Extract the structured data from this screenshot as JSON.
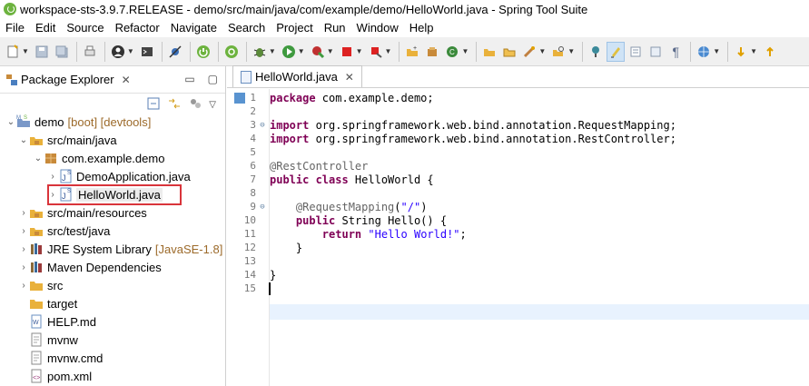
{
  "window": {
    "title": "workspace-sts-3.9.7.RELEASE - demo/src/main/java/com/example/demo/HelloWorld.java - Spring Tool Suite"
  },
  "menu": [
    "File",
    "Edit",
    "Source",
    "Refactor",
    "Navigate",
    "Search",
    "Project",
    "Run",
    "Window",
    "Help"
  ],
  "package_explorer": {
    "tab_label": "Package Explorer",
    "tree": [
      {
        "label": "demo",
        "deco": "[boot] [devtools]",
        "expanded": true,
        "level": 0,
        "icon": "project-icon"
      },
      {
        "label": "src/main/java",
        "deco": "",
        "expanded": true,
        "level": 1,
        "icon": "source-folder-icon"
      },
      {
        "label": "com.example.demo",
        "deco": "",
        "expanded": true,
        "level": 2,
        "icon": "package-icon"
      },
      {
        "label": "DemoApplication.java",
        "deco": "",
        "expanded": false,
        "level": 3,
        "icon": "java-file-icon"
      },
      {
        "label": "HelloWorld.java",
        "deco": "",
        "expanded": false,
        "level": 3,
        "icon": "java-file-icon"
      },
      {
        "label": "src/main/resources",
        "deco": "",
        "expanded": false,
        "level": 1,
        "icon": "source-folder-icon"
      },
      {
        "label": "src/test/java",
        "deco": "",
        "expanded": false,
        "level": 1,
        "icon": "source-folder-icon"
      },
      {
        "label": "JRE System Library",
        "deco": "[JavaSE-1.8]",
        "expanded": false,
        "level": 1,
        "icon": "library-icon"
      },
      {
        "label": "Maven Dependencies",
        "deco": "",
        "expanded": false,
        "level": 1,
        "icon": "library-icon"
      },
      {
        "label": "src",
        "deco": "",
        "expanded": false,
        "level": 1,
        "icon": "folder-icon"
      },
      {
        "label": "target",
        "deco": "",
        "expanded": null,
        "level": 1,
        "icon": "folder-icon"
      },
      {
        "label": "HELP.md",
        "deco": "",
        "expanded": null,
        "level": 1,
        "icon": "file-icon"
      },
      {
        "label": "mvnw",
        "deco": "",
        "expanded": null,
        "level": 1,
        "icon": "file-icon"
      },
      {
        "label": "mvnw.cmd",
        "deco": "",
        "expanded": null,
        "level": 1,
        "icon": "file-icon"
      },
      {
        "label": "pom.xml",
        "deco": "",
        "expanded": null,
        "level": 1,
        "icon": "xml-file-icon"
      }
    ]
  },
  "editor": {
    "tab_label": "HelloWorld.java",
    "lines": [
      {
        "n": "1",
        "fold": "",
        "code": "package com.example.demo;"
      },
      {
        "n": "2",
        "fold": "",
        "code": ""
      },
      {
        "n": "3",
        "fold": "⊖",
        "code": "import org.springframework.web.bind.annotation.RequestMapping;"
      },
      {
        "n": "4",
        "fold": "",
        "code": "import org.springframework.web.bind.annotation.RestController;"
      },
      {
        "n": "5",
        "fold": "",
        "code": ""
      },
      {
        "n": "6",
        "fold": "",
        "code": "@RestController"
      },
      {
        "n": "7",
        "fold": "",
        "code": "public class HelloWorld {"
      },
      {
        "n": "8",
        "fold": "",
        "code": ""
      },
      {
        "n": "9",
        "fold": "⊖",
        "code": "    @RequestMapping(\"/\")"
      },
      {
        "n": "10",
        "fold": "",
        "code": "    public String Hello() {"
      },
      {
        "n": "11",
        "fold": "",
        "code": "        return \"Hello World!\";"
      },
      {
        "n": "12",
        "fold": "",
        "code": "    }"
      },
      {
        "n": "13",
        "fold": "",
        "code": ""
      },
      {
        "n": "14",
        "fold": "",
        "code": "}"
      },
      {
        "n": "15",
        "fold": "",
        "code": ""
      }
    ]
  },
  "colors": {
    "keyword": "#7f0055",
    "annotation": "#646464",
    "string": "#2a00ff",
    "highlight_box": "#d9343b"
  }
}
